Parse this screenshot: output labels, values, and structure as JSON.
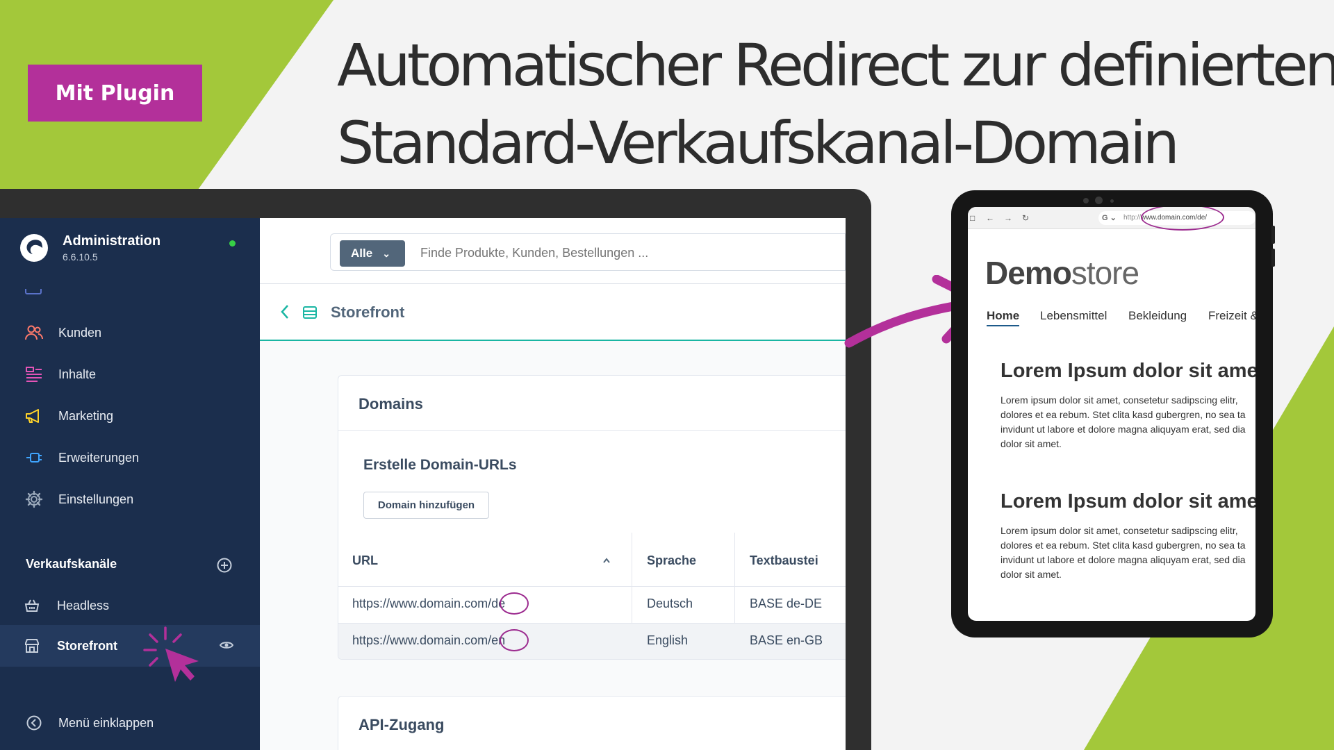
{
  "badge": {
    "label": "Mit Plugin"
  },
  "headline": {
    "line1": "Automatischer Redirect zur definierten",
    "line2": "Standard-Verkaufskanal-Domain"
  },
  "admin": {
    "app_title": "Administration",
    "version": "6.6.10.5",
    "search": {
      "filter_label": "Alle",
      "placeholder": "Finde Produkte, Kunden, Bestellungen ..."
    },
    "nav": [
      {
        "label": "Kunden",
        "icon": "customers-icon"
      },
      {
        "label": "Inhalte",
        "icon": "content-icon"
      },
      {
        "label": "Marketing",
        "icon": "megaphone-icon"
      },
      {
        "label": "Erweiterungen",
        "icon": "plug-icon"
      },
      {
        "label": "Einstellungen",
        "icon": "gear-icon"
      }
    ],
    "sales_channels": {
      "title": "Verkaufskanäle",
      "items": [
        {
          "label": "Headless",
          "icon": "basket-icon"
        },
        {
          "label": "Storefront",
          "icon": "storefront-icon",
          "active": true
        }
      ]
    },
    "collapse_label": "Menü einklappen",
    "page_title": "Storefront",
    "domains_card": {
      "title": "Domains",
      "subtitle": "Erstelle Domain-URLs",
      "add_button": "Domain hinzufügen",
      "columns": [
        "URL",
        "Sprache",
        "Textbaustei"
      ],
      "rows": [
        {
          "url": "https://www.domain.com/de",
          "language": "Deutsch",
          "snippet": "BASE de-DE"
        },
        {
          "url": "https://www.domain.com/en",
          "language": "English",
          "snippet": "BASE en-GB"
        }
      ]
    },
    "api_card": {
      "title": "API-Zugang"
    }
  },
  "tablet": {
    "url_prefix": "http://",
    "url": "www.domain.com/de/",
    "brand_bold": "Demo",
    "brand_light": "store",
    "nav": [
      "Home",
      "Lebensmittel",
      "Bekleidung",
      "Freizeit &"
    ],
    "sections": [
      {
        "title": "Lorem Ipsum dolor sit amet",
        "body": "Lorem ipsum dolor sit amet, consetetur sadipscing elitr, dolores et ea rebum. Stet clita kasd gubergren, no sea ta invidunt ut labore et dolore magna aliquyam erat, sed dia dolor sit amet."
      },
      {
        "title": "Lorem Ipsum dolor sit amet",
        "body": "Lorem ipsum dolor sit amet, consetetur sadipscing elitr, dolores et ea rebum. Stet clita kasd gubergren, no sea ta invidunt ut labore et dolore magna aliquyam erat, sed dia dolor sit amet."
      }
    ]
  },
  "colors": {
    "green": "#a3c83a",
    "magenta": "#b3309a",
    "sidebar": "#1b2e4d",
    "teal": "#1ab6a3"
  }
}
